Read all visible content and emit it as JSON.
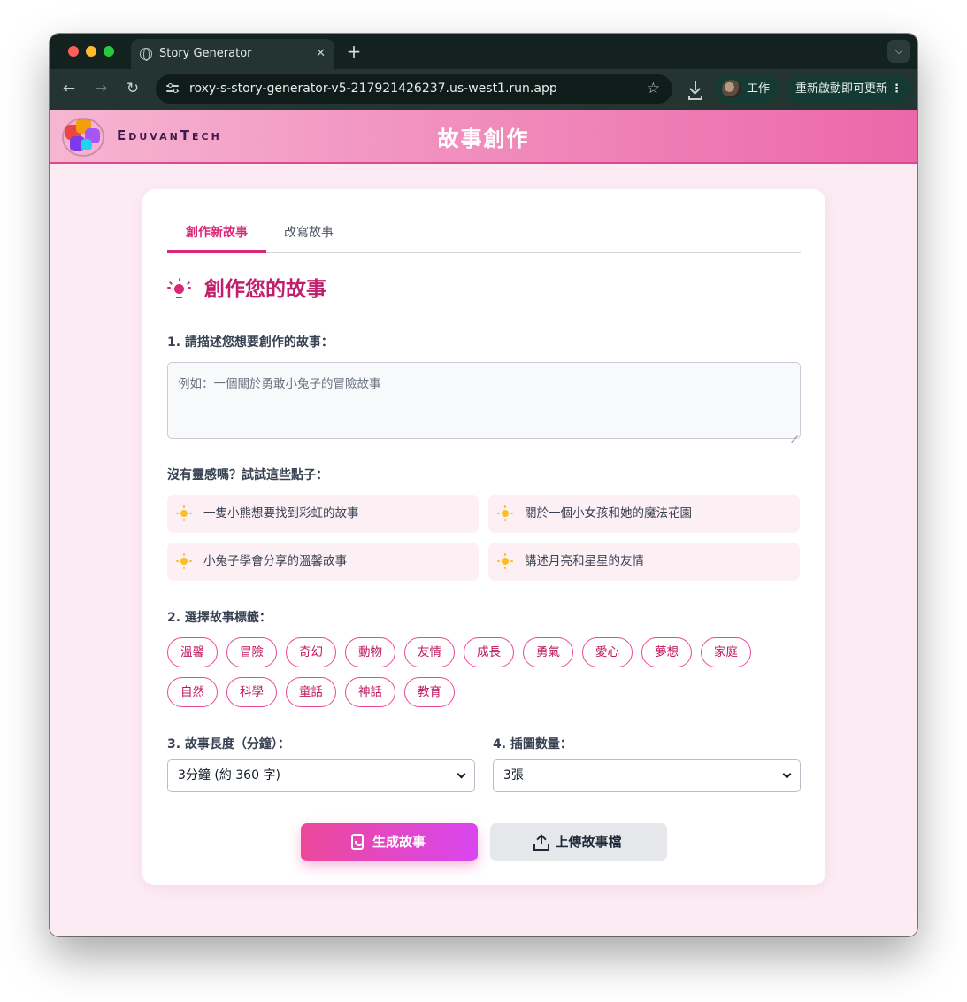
{
  "browser": {
    "tab_title": "Story Generator",
    "tab_close": "✕",
    "new_tab": "+",
    "url": "roxy-s-story-generator-v5-217921426237.us-west1.run.app",
    "profile_label": "工作",
    "update_label": "重新啟動即可更新",
    "icons": [
      "back-arrow-icon",
      "forward-arrow-icon",
      "reload-icon",
      "site-settings-icon",
      "bookmark-star-icon",
      "download-icon",
      "kebab-menu-icon"
    ]
  },
  "header": {
    "brand": "EduvanTech",
    "title": "故事創作"
  },
  "tabs": [
    {
      "label": "創作新故事",
      "active": true
    },
    {
      "label": "改寫故事",
      "active": false
    }
  ],
  "section": {
    "title": "創作您的故事",
    "icon": "lightbulb-icon"
  },
  "prompt": {
    "label": "1. 請描述您想要創作的故事：",
    "placeholder": "例如：一個關於勇敢小兔子的冒險故事"
  },
  "ideas": {
    "label": "沒有靈感嗎？試試這些點子：",
    "items": [
      "一隻小熊想要找到彩虹的故事",
      "關於一個小女孩和她的魔法花園",
      "小兔子學會分享的溫馨故事",
      "講述月亮和星星的友情"
    ]
  },
  "tags": {
    "label": "2. 選擇故事標籤：",
    "items": [
      "溫馨",
      "冒險",
      "奇幻",
      "動物",
      "友情",
      "成長",
      "勇氣",
      "愛心",
      "夢想",
      "家庭",
      "自然",
      "科學",
      "童話",
      "神話",
      "教育"
    ]
  },
  "length": {
    "label": "3. 故事長度（分鐘）：",
    "selected": "3分鐘 (約 360 字)"
  },
  "illustrations": {
    "label": "4. 插圖數量：",
    "selected": "3張"
  },
  "actions": {
    "generate": "生成故事",
    "upload": "上傳故事檔"
  },
  "colors": {
    "accent": "#db2777",
    "header_gradient_end": "#ec67a9",
    "page_bg": "#fcebf3",
    "idea_bg": "#fdf0f5",
    "generate_gradient": [
      "#ec4899",
      "#d946ef"
    ]
  }
}
